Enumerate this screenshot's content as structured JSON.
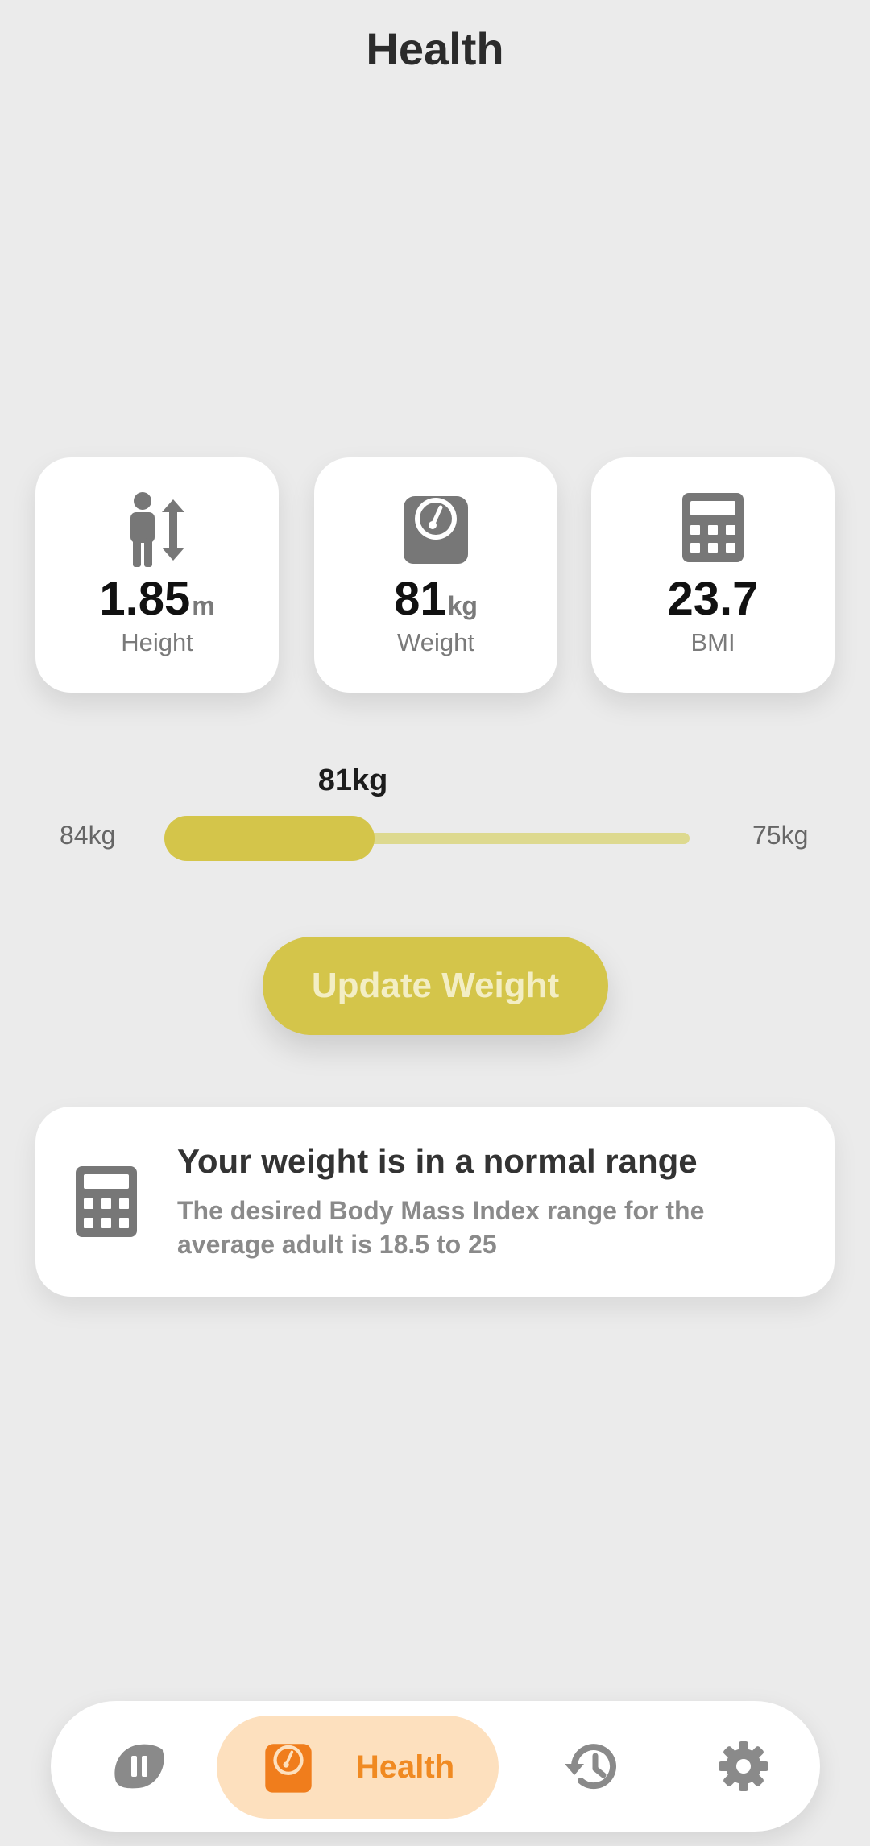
{
  "page_title": "Health",
  "stats": [
    {
      "icon": "height-icon",
      "value": "1.85",
      "unit": "m",
      "label": "Height"
    },
    {
      "icon": "weight-scale-icon",
      "value": "81",
      "unit": "kg",
      "label": "Weight"
    },
    {
      "icon": "calculator-icon",
      "value": "23.7",
      "unit": "",
      "label": "BMI"
    }
  ],
  "weight_slider": {
    "current": "81kg",
    "min_label": "84kg",
    "max_label": "75kg",
    "fill_fraction": 0.4
  },
  "update_button": {
    "label": "Update Weight"
  },
  "bmi_info": {
    "icon": "calculator-icon",
    "title": "Your weight is in a normal range",
    "description": "The desired Body Mass Index range for the average adult is 18.5 to 25"
  },
  "bottom_nav": {
    "items": [
      {
        "icon": "lemon-pause-icon",
        "label": "",
        "active": false
      },
      {
        "icon": "weight-scale-icon",
        "label": "Health",
        "active": true
      },
      {
        "icon": "history-icon",
        "label": "",
        "active": false
      },
      {
        "icon": "gear-icon",
        "label": "",
        "active": false
      }
    ]
  },
  "colors": {
    "background": "#ebebeb",
    "accent_yellow": "#d4c54a",
    "track_yellow": "#ddd98f",
    "nav_active_bg": "#fde0be",
    "nav_active_fg": "#f08a22",
    "icon_gray": "#777777"
  }
}
